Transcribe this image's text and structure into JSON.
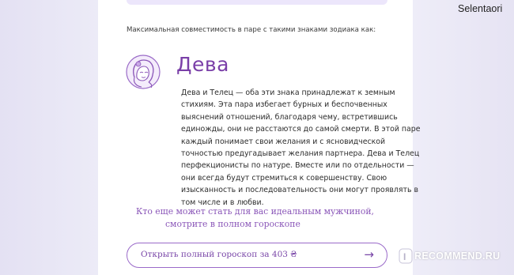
{
  "intro_text": "Максимальная совместимость в паре с такими знаками зодиака как:",
  "sign": {
    "title": "Дева",
    "icon": "virgo-woman-icon",
    "description_lines": [
      "Дева и Телец — оба эти знака принадлежат к земным",
      "стихиям. Эта пара избегает бурных и беспочвенных",
      "выяснений отношений, благодаря чему, встретившись",
      "единожды, они не расстаются до самой смерти. В этой паре",
      "каждый понимает свои желания и с ясновидческой",
      "точностью предугадывает желания партнера. Дева и Телец",
      "перфекционисты по натуре. Вместе или по отдельности —",
      "они всегда будут стремиться к совершенству. Свою",
      "изысканность и последовательность они могут проявлять в",
      "том числе и в любви."
    ]
  },
  "cta": {
    "line1": "Кто еще может стать для вас идеальным мужчиной,",
    "line2": "смотрите в полном гороскопе"
  },
  "button": {
    "label": "Открыть полный гороскоп за 403 ₴",
    "arrow": "→"
  },
  "watermark": {
    "username": "Selentaori",
    "site": "RECOMMEND.RU"
  },
  "colors": {
    "accent": "#7a3fa8",
    "page_bg": "#e9e7f5",
    "card_bg": "#ffffff"
  }
}
